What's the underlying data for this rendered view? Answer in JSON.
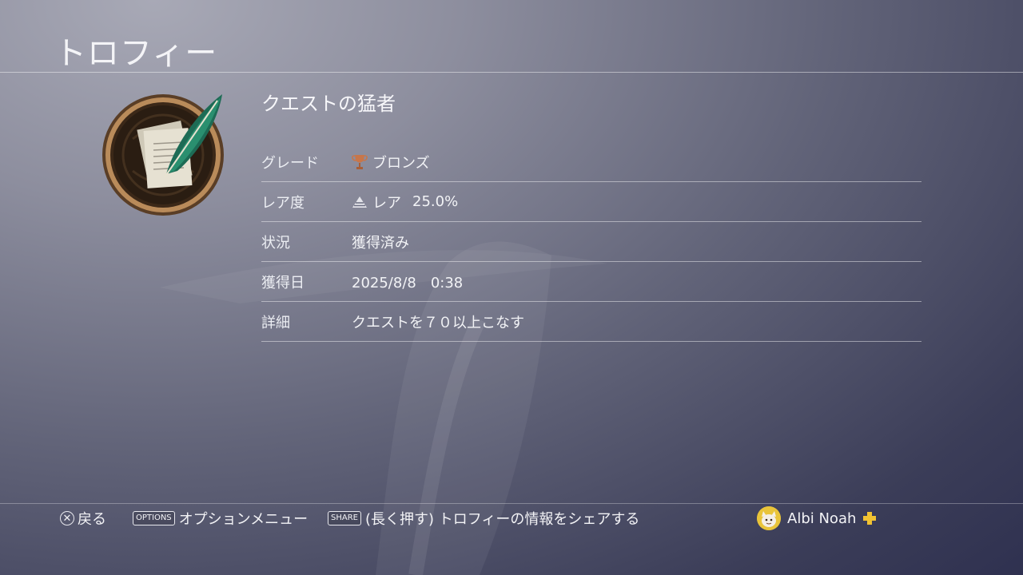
{
  "header": {
    "title": "トロフィー"
  },
  "trophy": {
    "icon": "quill-and-papers-icon",
    "name": "クエストの猛者",
    "rows": [
      {
        "label": "グレード",
        "value": "ブロンズ",
        "icon": "bronze-trophy-icon"
      },
      {
        "label": "レア度",
        "value": "レア",
        "extra": "25.0%",
        "icon": "rarity-pyramid-icon"
      },
      {
        "label": "状況",
        "value": "獲得済み"
      },
      {
        "label": "獲得日",
        "value": "2025/8/8　0:38"
      },
      {
        "label": "詳細",
        "value": "クエストを７０以上こなす"
      }
    ]
  },
  "footer": {
    "back_label": "戻る",
    "options_key": "OPTIONS",
    "options_label": "オプションメニュー",
    "share_key": "SHARE",
    "share_label": "(長く押す) トロフィーの情報をシェアする",
    "user_name": "Albi Noah"
  },
  "colors": {
    "bronze": "#c8764a",
    "plus_yellow": "#f1c232",
    "avatar_bg": "#e9c43a"
  }
}
